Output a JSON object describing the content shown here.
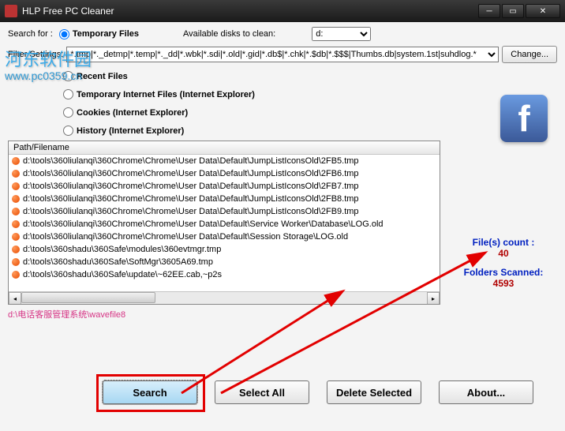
{
  "window": {
    "title": "HLP Free PC Cleaner"
  },
  "searchFor": {
    "label": "Search for :",
    "temporary": "Temporary Files"
  },
  "disks": {
    "label": "Available disks to clean:",
    "selected": "d:"
  },
  "filter": {
    "label": "Filter Settings:",
    "value": "*.tmp|*._detmp|*.temp|*._dd|*.wbk|*.sdi|*.old|*.gid|*.db$|*.chk|*.$db|*.$$$|Thumbs.db|system.1st|suhdlog.*",
    "changeBtn": "Change..."
  },
  "options": {
    "recent": "Recent Files",
    "tempie": "Temporary Internet Files (Internet Explorer)",
    "cookies": "Cookies  (Internet Explorer)",
    "history": "History  (Internet Explorer)"
  },
  "list": {
    "header": "Path/Filename",
    "rows": [
      "d:\\tools\\360liulanqi\\360Chrome\\Chrome\\User Data\\Default\\JumpListIconsOld\\2FB5.tmp",
      "d:\\tools\\360liulanqi\\360Chrome\\Chrome\\User Data\\Default\\JumpListIconsOld\\2FB6.tmp",
      "d:\\tools\\360liulanqi\\360Chrome\\Chrome\\User Data\\Default\\JumpListIconsOld\\2FB7.tmp",
      "d:\\tools\\360liulanqi\\360Chrome\\Chrome\\User Data\\Default\\JumpListIconsOld\\2FB8.tmp",
      "d:\\tools\\360liulanqi\\360Chrome\\Chrome\\User Data\\Default\\JumpListIconsOld\\2FB9.tmp",
      "d:\\tools\\360liulanqi\\360Chrome\\Chrome\\User Data\\Default\\Service Worker\\Database\\LOG.old",
      "d:\\tools\\360liulanqi\\360Chrome\\Chrome\\User Data\\Default\\Session Storage\\LOG.old",
      "d:\\tools\\360shadu\\360Safe\\modules\\360evtmgr.tmp",
      "d:\\tools\\360shadu\\360Safe\\SoftMgr\\3605A69.tmp",
      "d:\\tools\\360shadu\\360Safe\\update\\~62EE.cab,~p2s"
    ]
  },
  "status": "d:\\电话客服管理系统\\wavefile8",
  "stats": {
    "filesLabel": "File(s) count :",
    "filesValue": "40",
    "foldersLabel": "Folders Scanned:",
    "foldersValue": "4593"
  },
  "buttons": {
    "search": "Search",
    "selectAll": "Select All",
    "deleteSel": "Delete Selected",
    "about": "About..."
  },
  "watermark": {
    "text": "河东软件园",
    "url": "www.pc0359.cn"
  }
}
